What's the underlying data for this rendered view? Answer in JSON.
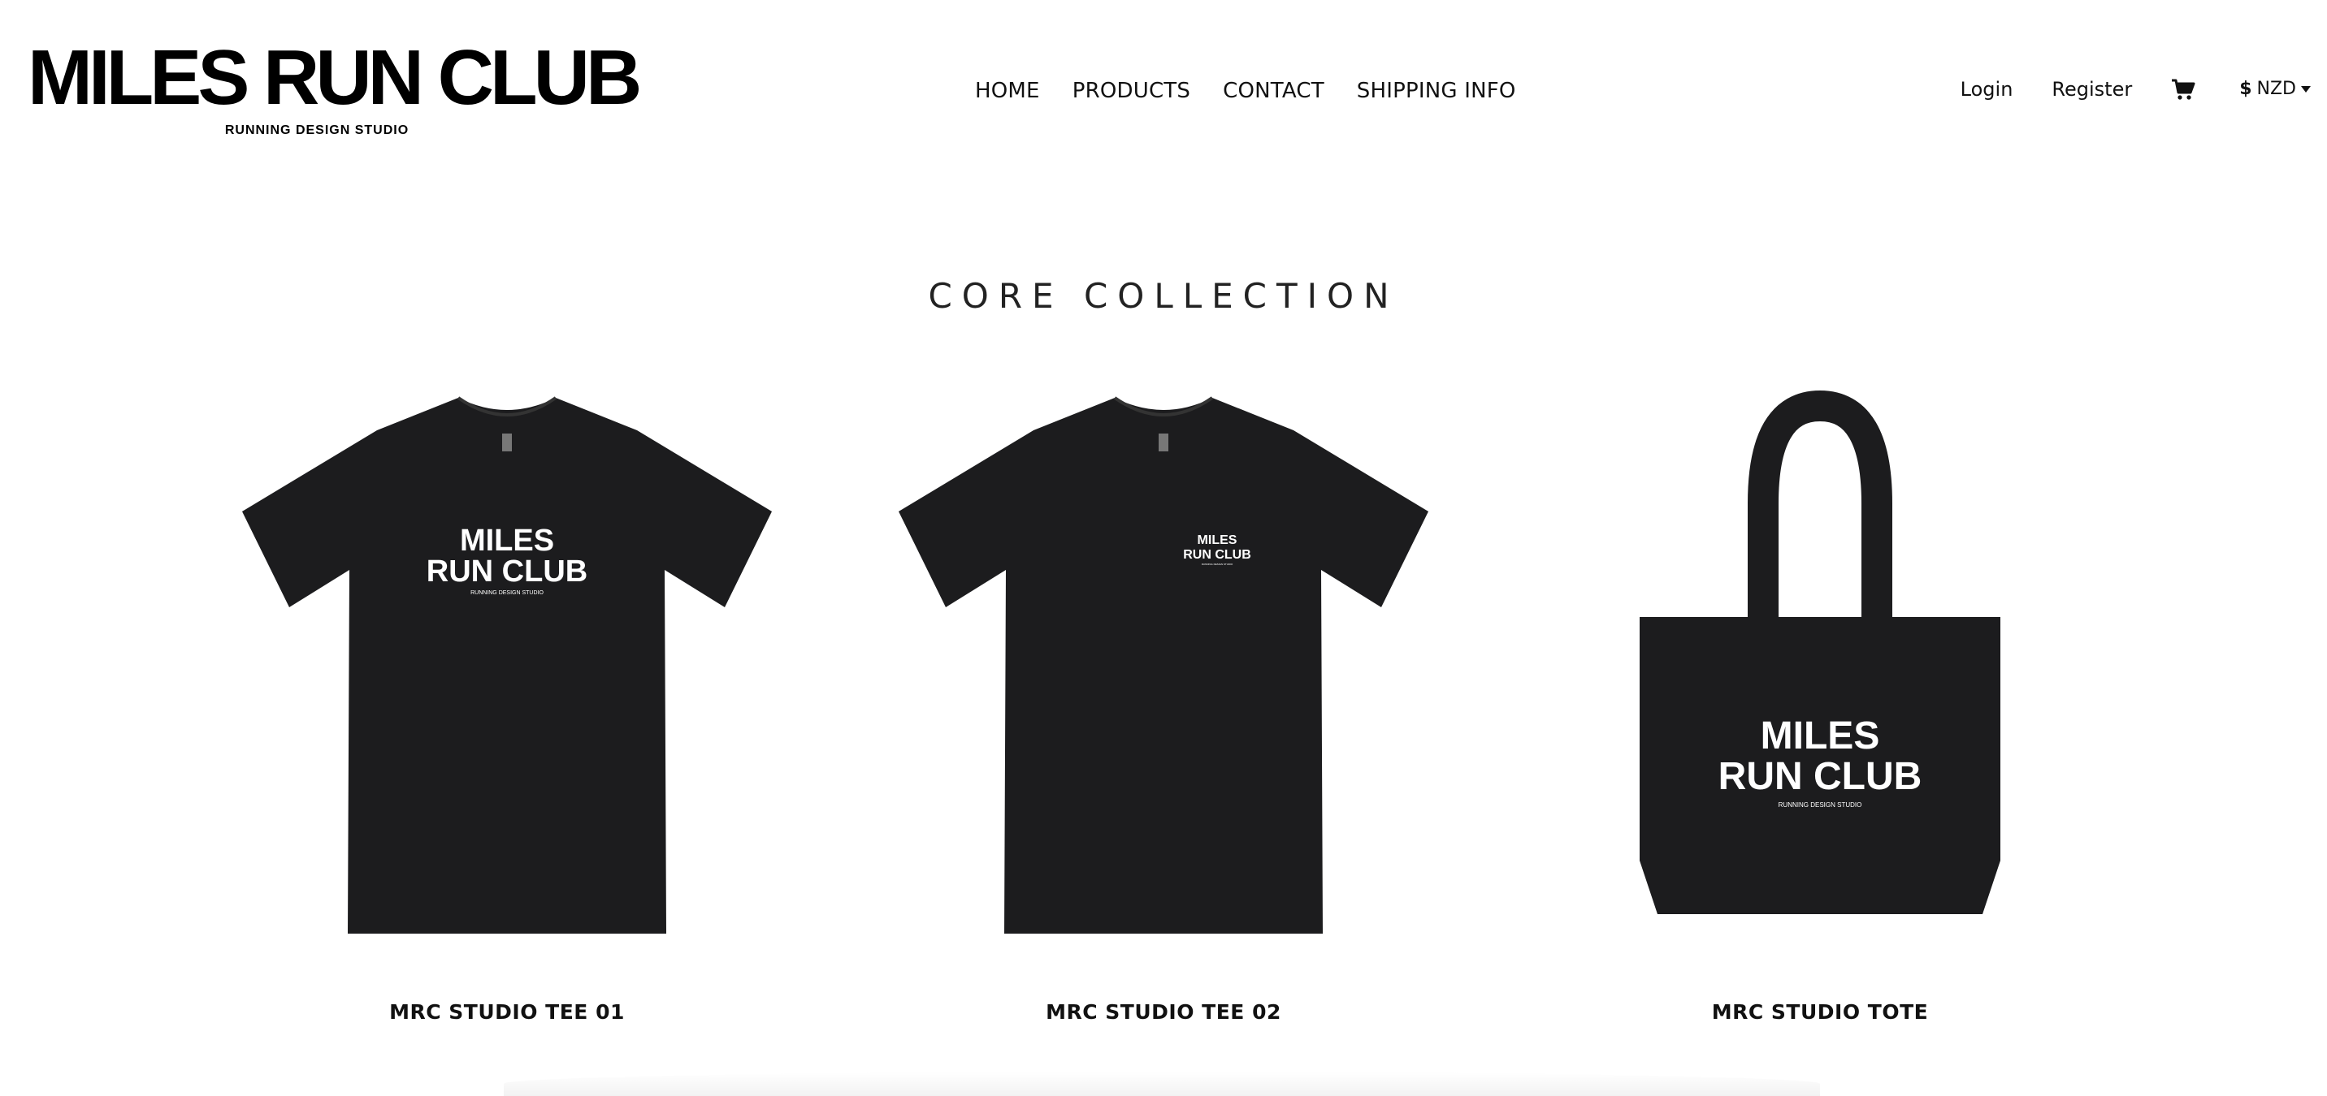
{
  "header": {
    "logo_title": "MILES RUN CLUB",
    "logo_subtitle": "RUNNING DESIGN STUDIO",
    "nav": [
      "HOME",
      "PRODUCTS",
      "CONTACT",
      "SHIPPING INFO"
    ],
    "login": "Login",
    "register": "Register",
    "cart_icon": "shopping-cart-icon",
    "currency_symbol": "$",
    "currency_code": "NZD"
  },
  "collection": {
    "title": "CORE COLLECTION",
    "products": [
      {
        "name": "MRC STUDIO TEE 01",
        "print_line1": "MILES",
        "print_line2": "RUN CLUB",
        "print_sub": "RUNNING DESIGN STUDIO"
      },
      {
        "name": "MRC STUDIO TEE 02",
        "print_line1": "MILES",
        "print_line2": "RUN CLUB",
        "print_sub": "RUNNING DESIGN STUDIO"
      },
      {
        "name": "MRC STUDIO TOTE",
        "print_line1": "MILES",
        "print_line2": "RUN CLUB",
        "print_sub": "RUNNING DESIGN STUDIO"
      }
    ]
  },
  "colors": {
    "background": "#ffffff",
    "text": "#111111",
    "garment": "#1c1c1e"
  }
}
